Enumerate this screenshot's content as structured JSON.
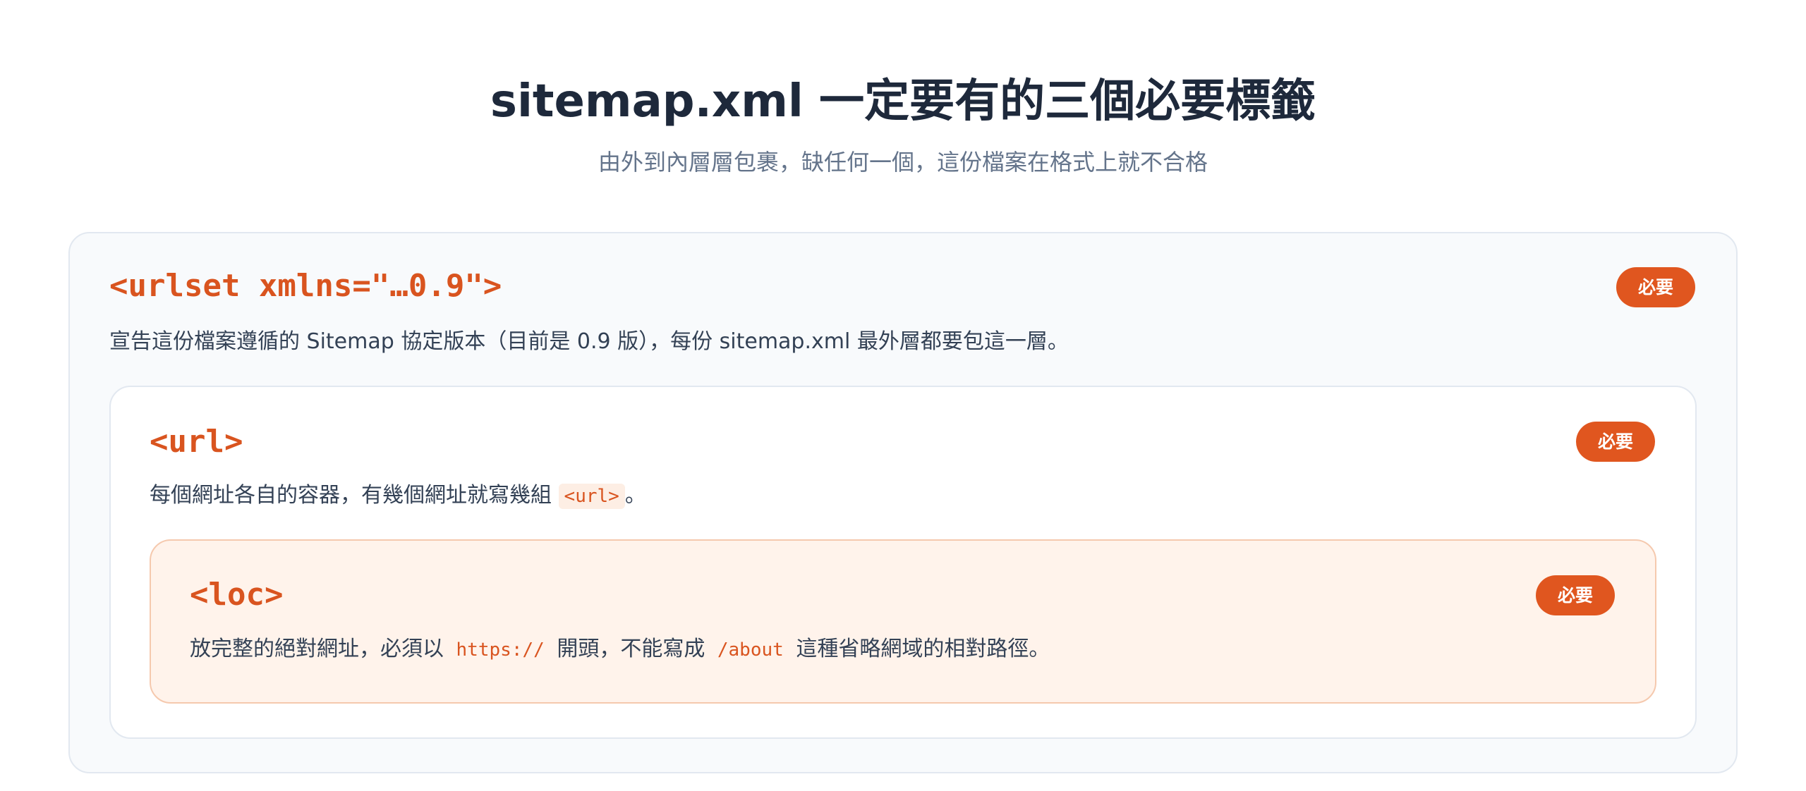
{
  "header": {
    "title": "sitemap.xml 一定要有的三個必要標籤",
    "subtitle": "由外到內層層包裹，缺任何一個，這份檔案在格式上就不合格"
  },
  "tags": {
    "urlset": {
      "name": "<urlset xmlns=\"…0.9\">",
      "badge": "必要",
      "description": "宣告這份檔案遵循的 Sitemap 協定版本（目前是 0.9 版），每份 sitemap.xml 最外層都要包這一層。"
    },
    "url": {
      "name": "<url>",
      "badge": "必要",
      "desc_before": "每個網址各自的容器，有幾個網址就寫幾組",
      "desc_code": "<url>",
      "desc_after": "。"
    },
    "loc": {
      "name": "<loc>",
      "badge": "必要",
      "desc_part1": "放完整的絕對網址，必須以",
      "desc_code1": "https://",
      "desc_part2": "開頭，不能寫成",
      "desc_code2": "/about",
      "desc_part3": "這種省略網域的相對路徑。"
    }
  },
  "colors": {
    "accent": "#e0561f",
    "tag_text": "#d9541f",
    "loc_background": "#fff3eb",
    "title_text": "#1e293b"
  }
}
